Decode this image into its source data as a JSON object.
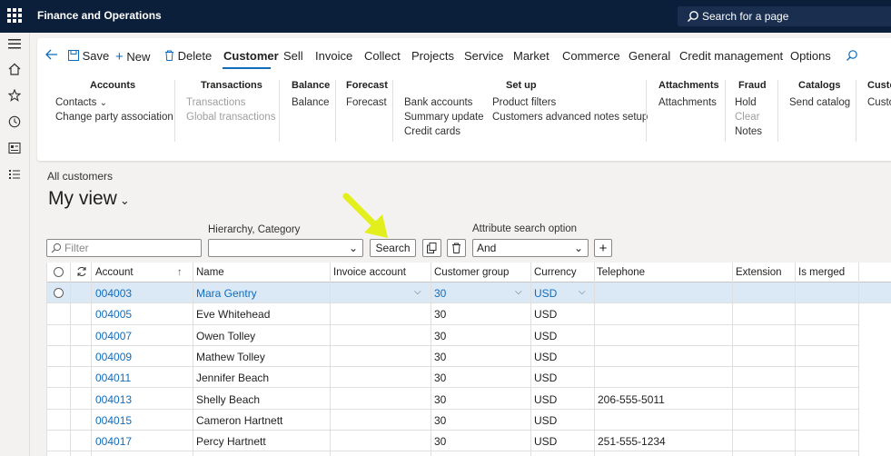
{
  "app_title": "Finance and Operations",
  "search_page": "Search for a page",
  "toolbar": {
    "save": "Save",
    "new": "New",
    "delete": "Delete"
  },
  "tabs": [
    "Customer",
    "Sell",
    "Invoice",
    "Collect",
    "Projects",
    "Service",
    "Market",
    "Commerce",
    "General",
    "Credit management",
    "Options"
  ],
  "active_tab": "Customer",
  "groups": {
    "accounts": {
      "title": "Accounts",
      "items": [
        "Contacts",
        "Change party association"
      ]
    },
    "transactions": {
      "title": "Transactions",
      "items": [
        "Transactions",
        "Global transactions"
      ]
    },
    "balance": {
      "title": "Balance",
      "items": [
        "Balance"
      ]
    },
    "forecast": {
      "title": "Forecast",
      "items": [
        "Forecast"
      ]
    },
    "setup": {
      "title": "Set up",
      "items": [
        "Bank accounts",
        "Summary update",
        "Credit cards",
        "Product filters",
        "Customers advanced notes setup"
      ]
    },
    "attachments": {
      "title": "Attachments",
      "items": [
        "Attachments"
      ]
    },
    "fraud": {
      "title": "Fraud",
      "items": [
        "Hold",
        "Clear",
        "Notes"
      ]
    },
    "catalogs": {
      "title": "Catalogs",
      "items": [
        "Send catalog"
      ]
    },
    "custo": {
      "title": "Custo",
      "items": [
        "Custo"
      ]
    }
  },
  "breadcrumb": "All customers",
  "view_title": "My view",
  "filter_placeholder": "Filter",
  "hierarchy_label": "Hierarchy, Category",
  "search_button": "Search",
  "attribute_label": "Attribute search option",
  "attribute_value": "And",
  "columns": [
    "Account",
    "Name",
    "Invoice account",
    "Customer group",
    "Currency",
    "Telephone",
    "Extension",
    "Is merged"
  ],
  "rows": [
    {
      "account": "004003",
      "name": "Mara Gentry",
      "invoice": "",
      "group": "30",
      "currency": "USD",
      "telephone": ""
    },
    {
      "account": "004005",
      "name": "Eve Whitehead",
      "invoice": "",
      "group": "30",
      "currency": "USD",
      "telephone": ""
    },
    {
      "account": "004007",
      "name": "Owen  Tolley",
      "invoice": "",
      "group": "30",
      "currency": "USD",
      "telephone": ""
    },
    {
      "account": "004009",
      "name": "Mathew Tolley",
      "invoice": "",
      "group": "30",
      "currency": "USD",
      "telephone": ""
    },
    {
      "account": "004011",
      "name": "Jennifer Beach",
      "invoice": "",
      "group": "30",
      "currency": "USD",
      "telephone": ""
    },
    {
      "account": "004013",
      "name": "Shelly Beach",
      "invoice": "",
      "group": "30",
      "currency": "USD",
      "telephone": "206-555-5011"
    },
    {
      "account": "004015",
      "name": "Cameron Hartnett",
      "invoice": "",
      "group": "30",
      "currency": "USD",
      "telephone": ""
    },
    {
      "account": "004017",
      "name": "Percy Hartnett",
      "invoice": "",
      "group": "30",
      "currency": "USD",
      "telephone": "251-555-1234"
    }
  ],
  "colors": {
    "topbar": "#0b1f3a",
    "accent": "#0f6cbd",
    "selected_row": "#dbe9f7",
    "arrow": "#e2ef1c"
  }
}
